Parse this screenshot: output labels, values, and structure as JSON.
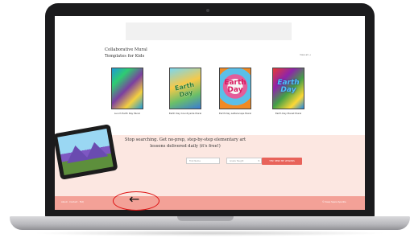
{
  "page": {
    "section_title": "Collaborative Mural Templates for Kids",
    "view_all": "View all →"
  },
  "products": [
    {
      "caption": "Lunch Earth Day Mural",
      "art_text": ""
    },
    {
      "caption": "Earth Day Countryside Mural",
      "art_text": "Earth Day"
    },
    {
      "caption": "Earth Day Letterscape Mural",
      "art_text": "Earth Day"
    },
    {
      "caption": "Earth Day Planet Mural",
      "art_text": "Earth Day"
    }
  ],
  "signup": {
    "headline": "Stop searching. Get no-prep, step-by-step elementary art lessons delivered daily (it's free!)",
    "first_name_placeholder": "First Name",
    "grade_placeholder": "Grade Taught",
    "submit_label": "YES! SEND ME LESSONS"
  },
  "footer": {
    "links": "About · Contact · FAQ",
    "copyright": "© Deep Space Sparkle"
  },
  "annotation": {
    "arrow": "←",
    "color": "#dd1111"
  }
}
